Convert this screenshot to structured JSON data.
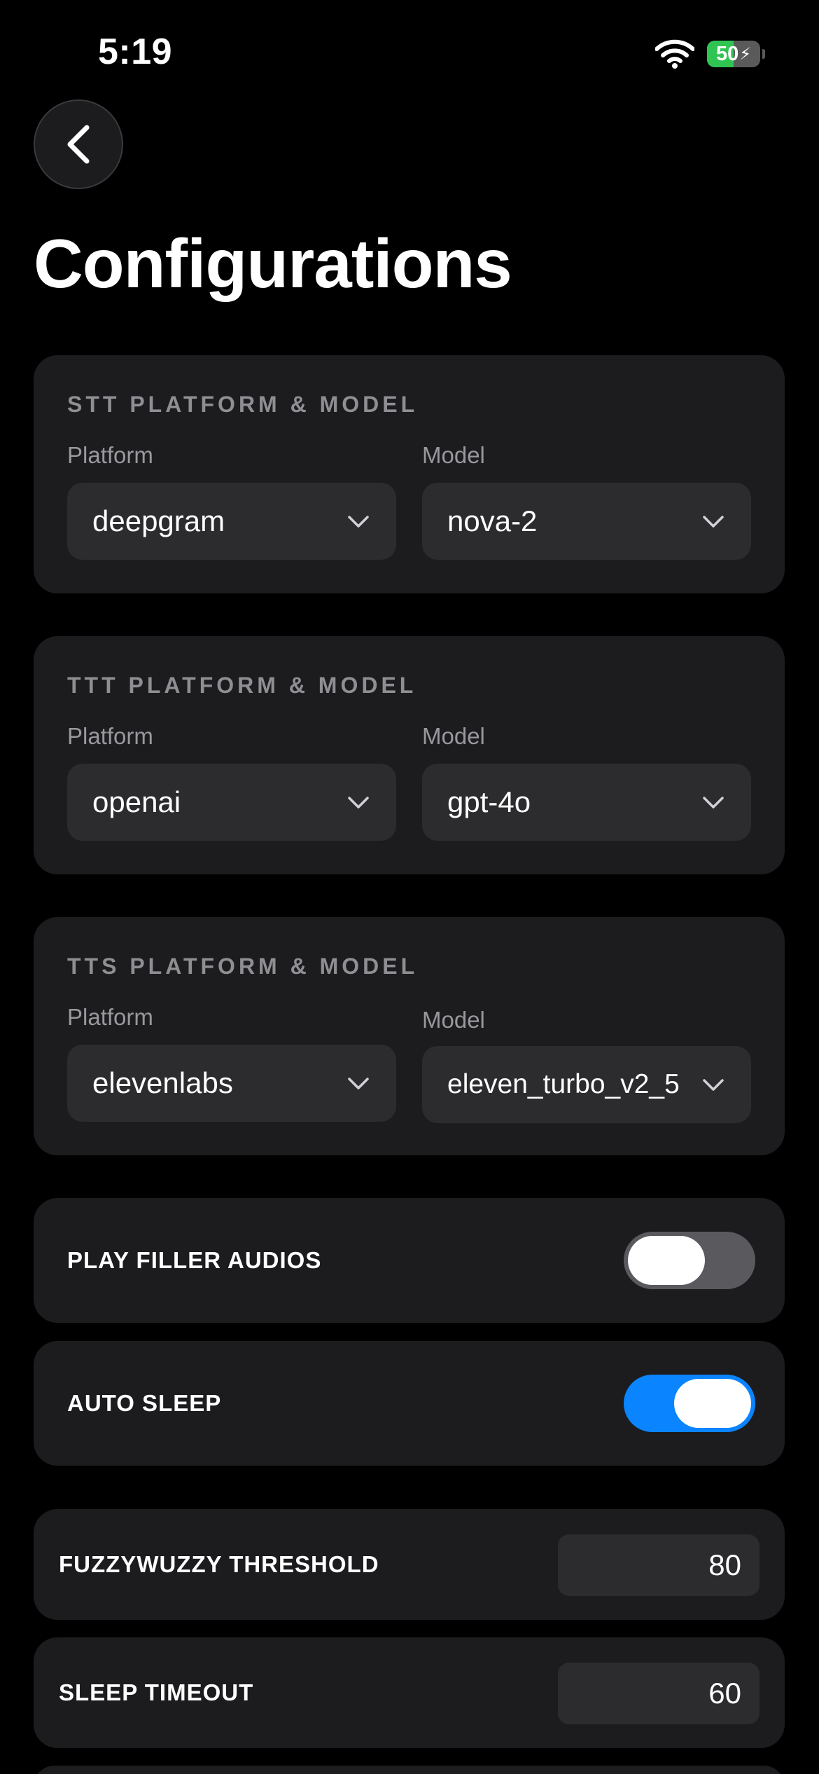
{
  "status_bar": {
    "time": "5:19",
    "battery_percent": "50",
    "battery_level": 0.5,
    "icons": [
      "wifi-icon",
      "battery-charging-icon"
    ],
    "battery_color": "#30c552"
  },
  "nav": {
    "back_icon": "chevron-left-icon"
  },
  "page": {
    "title": "Configurations"
  },
  "sections": [
    {
      "title": "STT PLATFORM & MODEL",
      "platform_label": "Platform",
      "platform_value": "deepgram",
      "model_label": "Model",
      "model_value": "nova-2"
    },
    {
      "title": "TTT PLATFORM & MODEL",
      "platform_label": "Platform",
      "platform_value": "openai",
      "model_label": "Model",
      "model_value": "gpt-4o"
    },
    {
      "title": "TTS PLATFORM & MODEL",
      "platform_label": "Platform",
      "platform_value": "elevenlabs",
      "model_label": "Model",
      "model_value": "eleven_turbo_v2_5"
    }
  ],
  "toggles": [
    {
      "label": "PLAY FILLER AUDIOS",
      "on": false
    },
    {
      "label": "AUTO SLEEP",
      "on": true
    }
  ],
  "numbers": [
    {
      "label": "FUZZYWUZZY THRESHOLD",
      "value": "80"
    },
    {
      "label": "SLEEP TIMEOUT",
      "value": "60"
    }
  ],
  "colors": {
    "toggle_on": "#0a84ff",
    "toggle_off": "#5a5a5e",
    "card_bg": "#1c1c1e",
    "field_bg": "#2c2c2e"
  }
}
